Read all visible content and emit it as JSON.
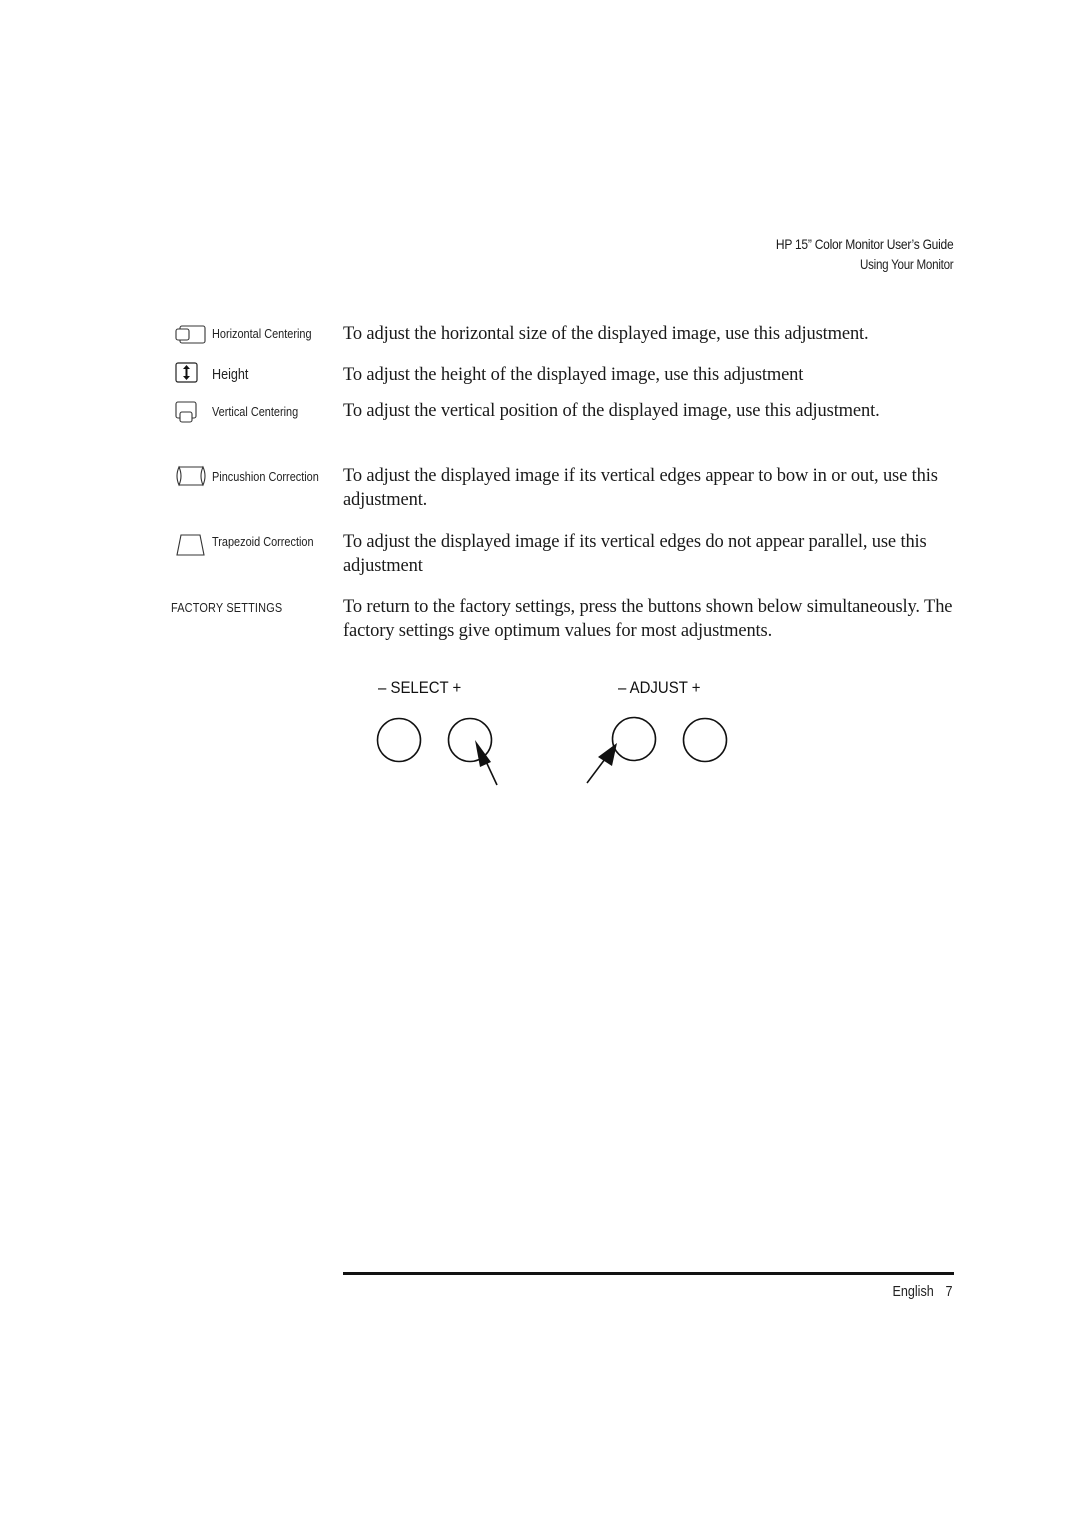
{
  "header": {
    "title": "HP 15” Color Monitor User’s Guide",
    "subtitle": "Using Your Monitor"
  },
  "adjustments": [
    {
      "icon": "horizontal-centering-icon",
      "label": "Horizontal Centering",
      "description": "To adjust the horizontal size of the displayed image, use this adjustment."
    },
    {
      "icon": "height-icon",
      "label": "Height",
      "description": "To adjust the height of the displayed image, use this adjustment"
    },
    {
      "icon": "vertical-centering-icon",
      "label": "Vertical Centering",
      "description": "To adjust the vertical position of the displayed image, use this adjustment."
    },
    {
      "icon": "pincushion-correction-icon",
      "label": "Pincushion Correction",
      "description": "To adjust the displayed image if its vertical edges appear to bow in or out, use this adjustment."
    },
    {
      "icon": "trapezoid-correction-icon",
      "label": "Trapezoid Correction",
      "description": "To adjust the displayed image if its vertical edges do not appear parallel, use this adjustment"
    }
  ],
  "factory_settings": {
    "label": "FACTORY SETTINGS",
    "description": "To return to the factory settings, press the buttons shown below simultaneously. The factory settings give optimum values for most adjustments."
  },
  "controls": {
    "select_label": "–  SELECT  +",
    "adjust_label": "–  ADJUST  +",
    "buttons": [
      {
        "name": "select-minus",
        "pressed": false
      },
      {
        "name": "select-plus",
        "pressed": true
      },
      {
        "name": "adjust-minus",
        "pressed": true
      },
      {
        "name": "adjust-plus",
        "pressed": false
      }
    ]
  },
  "footer": {
    "language": "English",
    "page_number": "7"
  }
}
